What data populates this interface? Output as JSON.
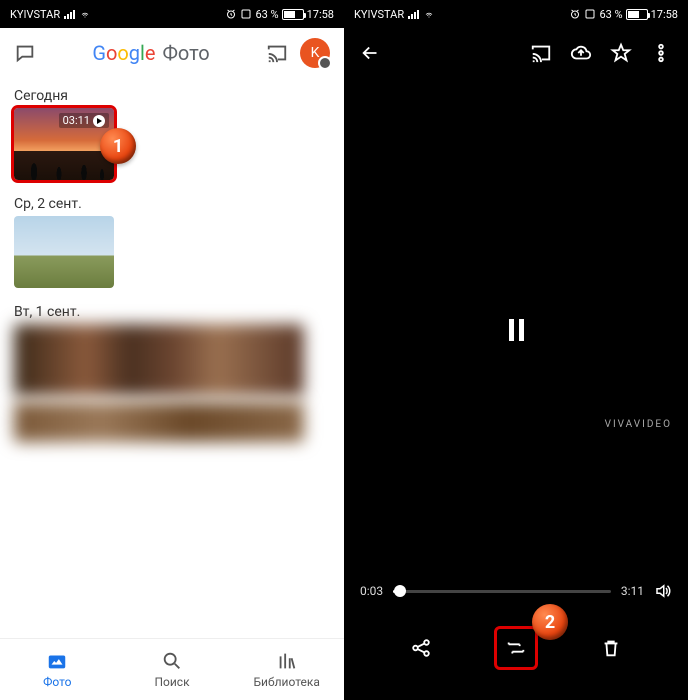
{
  "status": {
    "carrier": "KYIVSTAR",
    "battery_pct": "63 %",
    "time": "17:58"
  },
  "left": {
    "logo_text": "Фото",
    "avatar_initial": "K",
    "sections": [
      {
        "title": "Сегодня",
        "video_duration": "03:11"
      },
      {
        "title": "Ср, 2 сент."
      },
      {
        "title": "Вт, 1 сент."
      }
    ],
    "nav": {
      "photos": "Фото",
      "search": "Поиск",
      "library": "Библиотека"
    }
  },
  "right": {
    "watermark": "VIVAVIDEO",
    "elapsed": "0:03",
    "duration": "3:11"
  },
  "callouts": {
    "c1": "1",
    "c2": "2"
  }
}
